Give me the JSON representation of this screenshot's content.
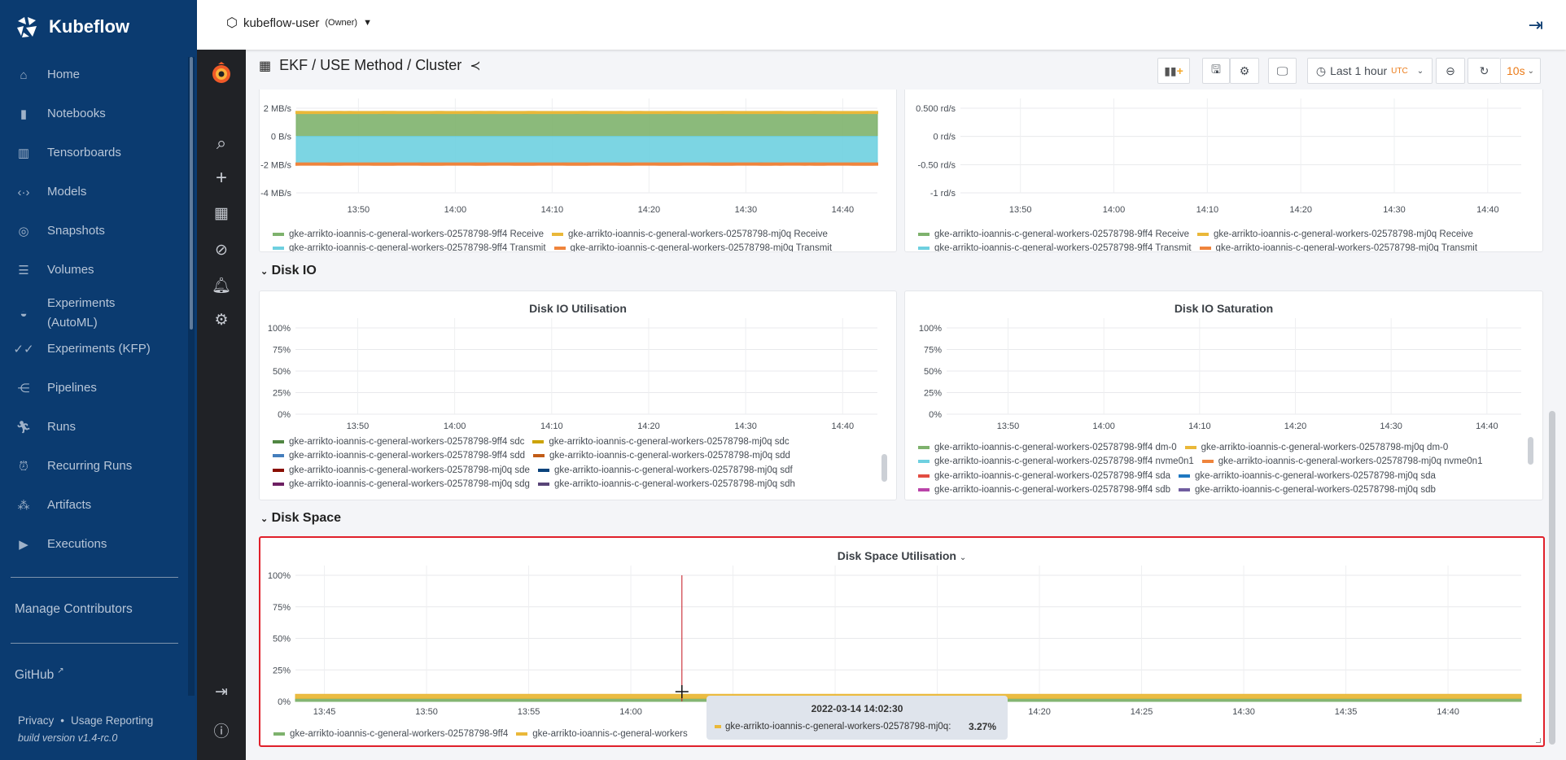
{
  "app": {
    "name": "Kubeflow",
    "namespace": "kubeflow-user",
    "role": "(Owner)"
  },
  "sidebar": {
    "items": [
      {
        "label": "Home",
        "icon": "home-icon"
      },
      {
        "label": "Notebooks",
        "icon": "notebook-icon"
      },
      {
        "label": "Tensorboards",
        "icon": "tensorboard-icon"
      },
      {
        "label": "Models",
        "icon": "models-icon"
      },
      {
        "label": "Snapshots",
        "icon": "snapshot-icon"
      },
      {
        "label": "Volumes",
        "icon": "volumes-icon"
      },
      {
        "label": "Experiments\n(AutoML)",
        "icon": "automl-icon"
      },
      {
        "label": "Experiments (KFP)",
        "icon": "kfp-icon"
      },
      {
        "label": "Pipelines",
        "icon": "pipelines-icon"
      },
      {
        "label": "Runs",
        "icon": "runs-icon"
      },
      {
        "label": "Recurring Runs",
        "icon": "alarm-icon"
      },
      {
        "label": "Artifacts",
        "icon": "artifacts-icon"
      },
      {
        "label": "Executions",
        "icon": "play-icon"
      }
    ],
    "manage_contributors": "Manage Contributors",
    "github": "GitHub",
    "privacy": "Privacy",
    "usage": "Usage Reporting",
    "build": "build version v1.4-rc.0"
  },
  "dashboard": {
    "breadcrumb": "EKF / USE Method / Cluster",
    "time_range": "Last 1 hour",
    "timezone": "UTC",
    "refresh_interval": "10s"
  },
  "rows": {
    "disk_io": "Disk IO",
    "disk_space": "Disk Space"
  },
  "panels": {
    "net_util": {
      "title": "",
      "y_ticks": [
        {
          "v": 2,
          "label": "2 MB/s"
        },
        {
          "v": 0,
          "label": "0 B/s"
        },
        {
          "v": -2,
          "label": "-2 MB/s"
        },
        {
          "v": -4,
          "label": "-4 MB/s"
        }
      ],
      "x_ticks": [
        "13:50",
        "14:00",
        "14:10",
        "14:20",
        "14:30",
        "14:40"
      ],
      "xlim": [
        "13:43:35",
        "14:43:35"
      ],
      "stacked": true,
      "series": [
        {
          "name": "gke-arrikto-ioannis-c-general-workers-02578798-9ff4 Receive",
          "color": "#7eb26d",
          "value": 1.65
        },
        {
          "name": "gke-arrikto-ioannis-c-general-workers-02578798-mj0q Receive",
          "color": "#eab839",
          "value": 0.1
        },
        {
          "name": "gke-arrikto-ioannis-c-general-workers-02578798-9ff4 Transmit",
          "color": "#6ed0e0",
          "value": -1.9
        },
        {
          "name": "gke-arrikto-ioannis-c-general-workers-02578798-mj0q Transmit",
          "color": "#ef843c",
          "value": -0.12
        }
      ]
    },
    "net_sat": {
      "title": "",
      "y_ticks": [
        {
          "v": 0.5,
          "label": "0.500 rd/s"
        },
        {
          "v": 0,
          "label": "0 rd/s"
        },
        {
          "v": -0.5,
          "label": "-0.50 rd/s"
        },
        {
          "v": -1,
          "label": "-1 rd/s"
        }
      ],
      "x_ticks": [
        "13:50",
        "14:00",
        "14:10",
        "14:20",
        "14:30",
        "14:40"
      ],
      "xlim": [
        "13:43:35",
        "14:43:35"
      ],
      "series": [
        {
          "name": "gke-arrikto-ioannis-c-general-workers-02578798-9ff4 Receive",
          "color": "#7eb26d"
        },
        {
          "name": "gke-arrikto-ioannis-c-general-workers-02578798-mj0q Receive",
          "color": "#eab839"
        },
        {
          "name": "gke-arrikto-ioannis-c-general-workers-02578798-9ff4 Transmit",
          "color": "#6ed0e0"
        },
        {
          "name": "gke-arrikto-ioannis-c-general-workers-02578798-mj0q Transmit",
          "color": "#ef843c"
        }
      ]
    },
    "disk_io_util": {
      "title": "Disk IO Utilisation",
      "y_ticks": [
        {
          "v": 100,
          "label": "100%"
        },
        {
          "v": 75,
          "label": "75%"
        },
        {
          "v": 50,
          "label": "50%"
        },
        {
          "v": 25,
          "label": "25%"
        },
        {
          "v": 0,
          "label": "0%"
        }
      ],
      "x_ticks": [
        "13:50",
        "14:00",
        "14:10",
        "14:20",
        "14:30",
        "14:40"
      ],
      "xlim": [
        "13:43:35",
        "14:43:35"
      ],
      "series": [
        {
          "name": "gke-arrikto-ioannis-c-general-workers-02578798-9ff4 sdc",
          "color": "#508642"
        },
        {
          "name": "gke-arrikto-ioannis-c-general-workers-02578798-mj0q sdc",
          "color": "#cca300"
        },
        {
          "name": "gke-arrikto-ioannis-c-general-workers-02578798-9ff4 sdd",
          "color": "#447ebc"
        },
        {
          "name": "gke-arrikto-ioannis-c-general-workers-02578798-mj0q sdd",
          "color": "#c15c17"
        },
        {
          "name": "gke-arrikto-ioannis-c-general-workers-02578798-mj0q sde",
          "color": "#890f02"
        },
        {
          "name": "gke-arrikto-ioannis-c-general-workers-02578798-mj0q sdf",
          "color": "#0a437c"
        },
        {
          "name": "gke-arrikto-ioannis-c-general-workers-02578798-mj0q sdg",
          "color": "#6d1f62"
        },
        {
          "name": "gke-arrikto-ioannis-c-general-workers-02578798-mj0q sdh",
          "color": "#584477"
        }
      ]
    },
    "disk_io_sat": {
      "title": "Disk IO Saturation",
      "y_ticks": [
        {
          "v": 100,
          "label": "100%"
        },
        {
          "v": 75,
          "label": "75%"
        },
        {
          "v": 50,
          "label": "50%"
        },
        {
          "v": 25,
          "label": "25%"
        },
        {
          "v": 0,
          "label": "0%"
        }
      ],
      "x_ticks": [
        "13:50",
        "14:00",
        "14:10",
        "14:20",
        "14:30",
        "14:40"
      ],
      "xlim": [
        "13:43:35",
        "14:43:35"
      ],
      "series": [
        {
          "name": "gke-arrikto-ioannis-c-general-workers-02578798-9ff4 dm-0",
          "color": "#7eb26d"
        },
        {
          "name": "gke-arrikto-ioannis-c-general-workers-02578798-mj0q dm-0",
          "color": "#eab839"
        },
        {
          "name": "gke-arrikto-ioannis-c-general-workers-02578798-9ff4 nvme0n1",
          "color": "#6ed0e0"
        },
        {
          "name": "gke-arrikto-ioannis-c-general-workers-02578798-mj0q nvme0n1",
          "color": "#ef843c"
        },
        {
          "name": "gke-arrikto-ioannis-c-general-workers-02578798-9ff4 sda",
          "color": "#e24d42"
        },
        {
          "name": "gke-arrikto-ioannis-c-general-workers-02578798-mj0q sda",
          "color": "#1f78c1"
        },
        {
          "name": "gke-arrikto-ioannis-c-general-workers-02578798-9ff4 sdb",
          "color": "#ba43a9"
        },
        {
          "name": "gke-arrikto-ioannis-c-general-workers-02578798-mj0q sdb",
          "color": "#705da0"
        }
      ]
    },
    "disk_space": {
      "title": "Disk Space Utilisation",
      "y_ticks": [
        {
          "v": 100,
          "label": "100%"
        },
        {
          "v": 75,
          "label": "75%"
        },
        {
          "v": 50,
          "label": "50%"
        },
        {
          "v": 25,
          "label": "25%"
        },
        {
          "v": 0,
          "label": "0%"
        }
      ],
      "x_ticks": [
        "13:45",
        "13:50",
        "13:55",
        "14:00",
        "14:05",
        "14:10",
        "14:15",
        "14:20",
        "14:25",
        "14:30",
        "14:35",
        "14:40"
      ],
      "xlim": [
        "13:43:35",
        "14:43:35"
      ],
      "stacked": true,
      "series": [
        {
          "name": "gke-arrikto-ioannis-c-general-workers-02578798-9ff4",
          "color": "#7eb26d",
          "value": 2.4
        },
        {
          "name": "gke-arrikto-ioannis-c-general-workers-02578798-mj0q",
          "color": "#eab839",
          "value": 3.27
        }
      ],
      "legend_visible": [
        "gke-arrikto-ioannis-c-general-workers-02578798-9ff4",
        "gke-arrikto-ioannis-c-general-workers"
      ],
      "crosshair_time": "14:02:30",
      "tooltip": {
        "time": "2022-03-14 14:02:30",
        "series": "gke-arrikto-ioannis-c-general-workers-02578798-mj0q:",
        "value": "3.27%",
        "color": "#eab839"
      }
    }
  }
}
